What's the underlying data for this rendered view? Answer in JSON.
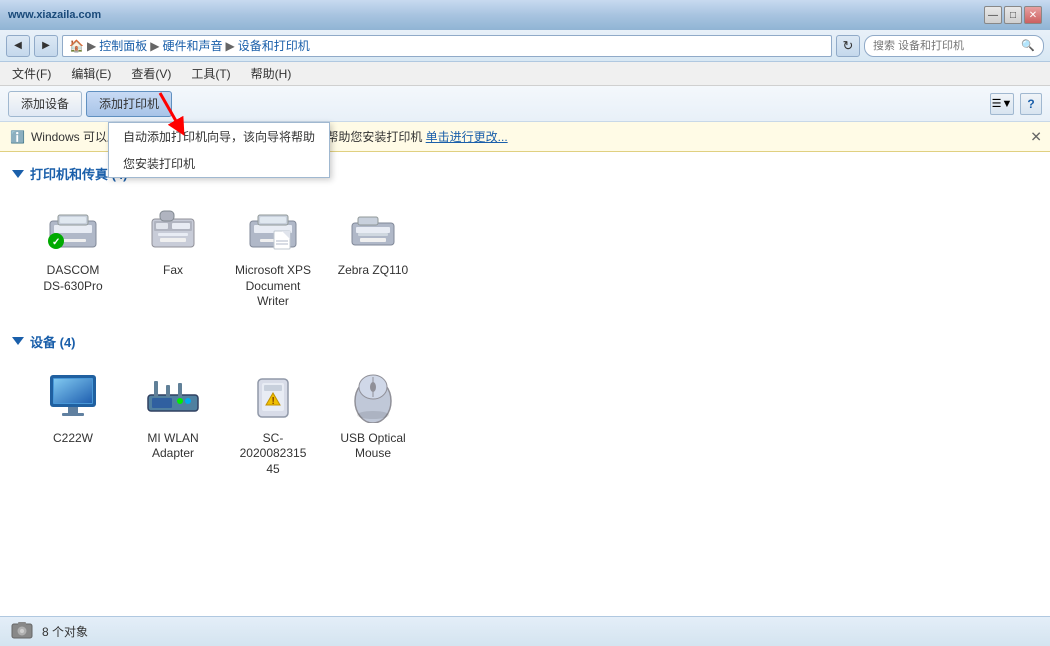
{
  "titlebar": {
    "website": "www.xiazaila.com",
    "controls": {
      "minimize": "—",
      "maximize": "□",
      "close": "✕"
    }
  },
  "addressbar": {
    "nav_back": "◀",
    "nav_forward": "▶",
    "breadcrumbs": [
      {
        "label": "控制面板"
      },
      {
        "label": "硬件和声音"
      },
      {
        "label": "设备和打印机"
      }
    ],
    "refresh": "↻",
    "search_placeholder": "搜索 设备和打印机"
  },
  "menubar": {
    "items": [
      {
        "label": "文件(F)"
      },
      {
        "label": "编辑(E)"
      },
      {
        "label": "查看(V)"
      },
      {
        "label": "工具(T)"
      },
      {
        "label": "帮助(H)"
      }
    ]
  },
  "toolbar": {
    "add_device": "添加设备",
    "add_printer": "添加打印机",
    "view_options": "▼",
    "help": "?"
  },
  "tooltip": {
    "items": [
      {
        "label": "自动添加打印机向导，该向导将帮助您安装打印机"
      },
      {
        "label": "您安装打印机"
      }
    ]
  },
  "notification": {
    "text": "Windows 可以显示增强",
    "mid_text": "自动添加打印机向导，该向导将帮助您安装打印机",
    "link": "单击进行更改...",
    "close": "✕"
  },
  "sections": {
    "printers": {
      "label": "打印机和传真 (4)",
      "items": [
        {
          "name": "DASCOM\nDS-630Pro",
          "type": "printer",
          "has_check": true
        },
        {
          "name": "Fax",
          "type": "fax"
        },
        {
          "name": "Microsoft XPS\nDocument\nWriter",
          "type": "xps_printer"
        },
        {
          "name": "Zebra ZQ110",
          "type": "zebra_printer"
        }
      ]
    },
    "devices": {
      "label": "设备 (4)",
      "items": [
        {
          "name": "C222W",
          "type": "monitor"
        },
        {
          "name": "MI WLAN\nAdapter",
          "type": "router"
        },
        {
          "name": "SC-2020082315\n45",
          "type": "device_warning"
        },
        {
          "name": "USB Optical\nMouse",
          "type": "mouse"
        }
      ]
    }
  },
  "statusbar": {
    "icon": "📷",
    "count": "8 个对象"
  }
}
